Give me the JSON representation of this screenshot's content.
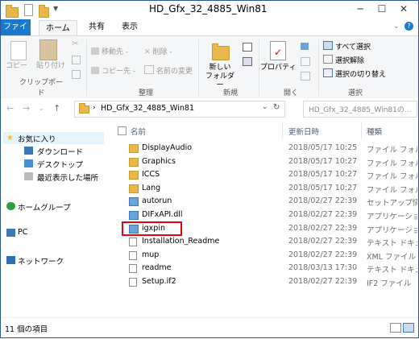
{
  "window": {
    "title": "HD_Gfx_32_4885_Win81"
  },
  "ribbon_tabs": [
    "ファイル",
    "ホーム",
    "共有",
    "表示"
  ],
  "ribbon": {
    "clipboard": {
      "copy": "コピー",
      "paste": "貼り付け",
      "label": "クリップボード"
    },
    "organize": {
      "move_to": "移動先 -",
      "copy_to": "コピー先 -",
      "delete": "削除 -",
      "rename": "名前の変更",
      "label": "整理"
    },
    "new": {
      "new_folder": "新しい\nフォルダー",
      "new_folder_l1": "新しい",
      "new_folder_l2": "フォルダー",
      "label": "新規"
    },
    "open": {
      "properties": "プロパティ",
      "label": "開く"
    },
    "select": {
      "select_all": "すべて選択",
      "select_none": "選択解除",
      "invert": "選択の切り替え",
      "label": "選択"
    }
  },
  "address": {
    "path": "HD_Gfx_32_4885_Win81",
    "search_placeholder": "HD_Gfx_32_4885_Win81の..."
  },
  "nav": {
    "favorites": "お気に入り",
    "downloads": "ダウンロード",
    "desktop": "デスクトップ",
    "recent": "最近表示した場所",
    "homegroup": "ホームグループ",
    "pc": "PC",
    "network": "ネットワーク"
  },
  "columns": {
    "name": "名前",
    "date": "更新日時",
    "type": "種類"
  },
  "files": [
    {
      "name": "DisplayAudio",
      "date": "2018/05/17 10:25",
      "type": "ファイル フォルダー",
      "icon": "folder-icon"
    },
    {
      "name": "Graphics",
      "date": "2018/05/17 10:27",
      "type": "ファイル フォルダー",
      "icon": "folder-icon"
    },
    {
      "name": "ICCS",
      "date": "2018/05/17 10:27",
      "type": "ファイル フォルダー",
      "icon": "folder-icon"
    },
    {
      "name": "Lang",
      "date": "2018/05/17 10:27",
      "type": "ファイル フォルダー",
      "icon": "folder-icon"
    },
    {
      "name": "autorun",
      "date": "2018/02/27 22:39",
      "type": "セットアップ情報",
      "icon": "setup-info-icon"
    },
    {
      "name": "DIFxAPI.dll",
      "date": "2018/02/27 22:39",
      "type": "アプリケーション拡張",
      "icon": "dll-icon"
    },
    {
      "name": "igxpin",
      "date": "2018/02/27 22:39",
      "type": "アプリケーション",
      "icon": "application-icon"
    },
    {
      "name": "Installation_Readme",
      "date": "2018/02/27 22:39",
      "type": "テキスト ドキュメント",
      "icon": "text-document-icon"
    },
    {
      "name": "mup",
      "date": "2018/02/27 22:39",
      "type": "XML ファイル",
      "icon": "xml-file-icon"
    },
    {
      "name": "readme",
      "date": "2018/03/13 17:30",
      "type": "テキスト ドキュメント",
      "icon": "text-document-icon"
    },
    {
      "name": "Setup.if2",
      "date": "2018/02/27 22:39",
      "type": "IF2 ファイル",
      "icon": "if2-file-icon"
    }
  ],
  "status": {
    "item_count": "11 個の項目"
  },
  "colors": {
    "file_tab": "#1979ca",
    "highlight": "#e60012",
    "folder": "#e8b84a"
  }
}
